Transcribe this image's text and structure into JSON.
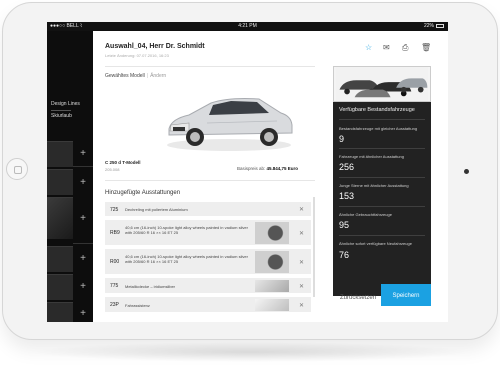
{
  "status_bar": {
    "carrier": "●●●○○ BELL ⌇",
    "time": "4:21 PM",
    "battery_icon": "bluetooth-battery",
    "battery": "22%"
  },
  "sidebar": {
    "items": [
      {
        "label": "Design Lines"
      },
      {
        "label": "Skiurlaub"
      }
    ],
    "plus_glyph": "+"
  },
  "header": {
    "title": "Auswahl_04, Herr Dr. Schmidt",
    "subtitle": "Letzte Änderung: 07.07.2016, 16:23",
    "edit_icon": "pencil-icon",
    "actions": [
      {
        "icon": "star-icon"
      },
      {
        "icon": "mail-icon"
      },
      {
        "icon": "print-icon"
      },
      {
        "icon": "trash-icon"
      }
    ],
    "accent": "#1ba1e2"
  },
  "model": {
    "label": "Gewähltes Modell",
    "change": "Ändern",
    "name": "C 250 d T-Modell",
    "code": "205.008",
    "price_label": "Basispreis ab:",
    "price": "45.844,75 Euro"
  },
  "options": {
    "title": "Hinzugefügte Ausstattungen",
    "items": [
      {
        "code": "725",
        "text": "Dechreling mit poliertem Aluminium",
        "thumb": false
      },
      {
        "code": "RB9",
        "text": "40,6 cm (16-inch) 10-spoke light alloy wheels painted in vadium silver with 205/60 R 16 ×× 16 ET 25",
        "thumb": true
      },
      {
        "code": "R00",
        "text": "40,6 cm (16-inch) 10-spoke light alloy wheels painted in vadium silver with 205/60 R 16 ×× 16 ET 25",
        "thumb": true
      },
      {
        "code": "775",
        "text": "Metallicdecke – iridiumsilber",
        "thumb": true
      },
      {
        "code": "23P",
        "text": "Fahrassistenz",
        "thumb": true
      }
    ]
  },
  "right_panel": {
    "title": "Verfügbare Bestandsfahrzeuge",
    "stats": [
      {
        "label": "Bestandsfahrzeuge mit gleicher Ausstattung",
        "value": "9"
      },
      {
        "label": "Fahrzeuge mit ähnlicher Ausstattung",
        "value": "256"
      },
      {
        "label": "Junge Sterne mit ähnlicher Ausstattung",
        "value": "153"
      },
      {
        "label": "Ähnliche Gebrauchtfahrzeuge",
        "value": "95"
      },
      {
        "label": "Ähnliche sofort verfügbare Neufahrzeuge",
        "value": "76"
      }
    ]
  },
  "footer": {
    "reset": "Zurücksetzen",
    "save": "Speichern"
  }
}
